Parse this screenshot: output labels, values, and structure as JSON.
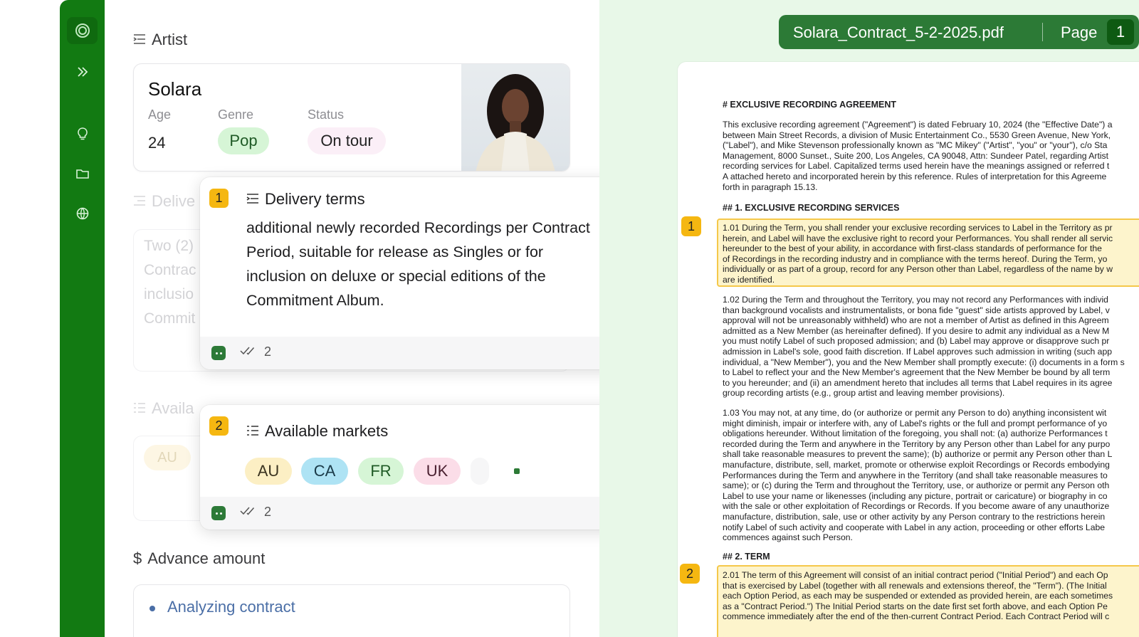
{
  "sidebar": {
    "icons": [
      "logo-ring-icon",
      "expand-chevrons-icon",
      "lightbulb-icon",
      "folder-icon",
      "globe-icon"
    ]
  },
  "artist_section": {
    "title": "Artist",
    "name": "Solara",
    "age_label": "Age",
    "age": "24",
    "genre_label": "Genre",
    "genre": "Pop",
    "status_label": "Status",
    "status": "On tour"
  },
  "faded": {
    "delivery_title": "Delive",
    "delivery_lines": [
      "Two (2)",
      "Contrac",
      "inclusio",
      "Commit"
    ],
    "markets_title": "Availa",
    "market_chip": "AU"
  },
  "popover_delivery": {
    "badge": "1",
    "title": "Delivery terms",
    "body": "additional newly recorded Recordings per Contract Period, suitable for release as Singles or for inclusion on deluxe or special editions of the Commitment Album.",
    "check_count": "2"
  },
  "popover_markets": {
    "badge": "2",
    "title": "Available markets",
    "markets": [
      "AU",
      "CA",
      "FR",
      "UK"
    ],
    "check_count": "2"
  },
  "advance": {
    "title": "Advance amount",
    "status": "Analyzing contract"
  },
  "document": {
    "file_name": "Solara_Contract_5-2-2025.pdf",
    "page_label": "Page",
    "page_number": "1",
    "heading": "# EXCLUSIVE RECORDING AGREEMENT",
    "intro_lines": [
      "This exclusive recording agreement (\"Agreement\") is dated February 10, 2024 (the \"Effective Date\") a",
      "between Main Street Records, a division of Music Entertainment Co., 5530 Green Avenue, New York,",
      "(\"Label\"), and Mike Stevenson professionally known as \"MC Mikey\" (\"Artist\", \"you\" or \"your\"), c/o Sta",
      "Management, 8000 Sunset., Suite 200, Los Angeles, CA 90048, Attn: Sundeer Patel, regarding Artist",
      "recording services for Label. Capitalized terms used herein have the meanings assigned or referred t",
      "A attached hereto and incorporated herein by this reference. Rules of interpretation for this Agreeme",
      "forth in paragraph 15.13."
    ],
    "section1_heading": "## 1. EXCLUSIVE RECORDING SERVICES",
    "badge1": "1",
    "p101_lines": [
      "1.01 During the Term, you shall render your exclusive recording services to Label in the Territory as pr",
      "herein, and Label will have the exclusive right to record your Performances. You shall render all servic",
      "hereunder to the best of your ability, in accordance with first-class standards of performance for the",
      "of Recordings in the recording industry and in compliance with the terms hereof. During the Term, yo",
      "individually or as part of a group, record for any Person other than Label, regardless of the name by w",
      "are identified."
    ],
    "p102_lines": [
      "1.02 During the Term and throughout the Territory, you may not record any Performances with individ",
      "than background vocalists and instrumentalists, or bona fide \"guest\" side artists approved by Label, v",
      "approval will not be unreasonably withheld) who are not a member of Artist as defined in this Agreem",
      "admitted as a New Member (as hereinafter defined). If you desire to admit any individual as a New M",
      "you must notify Label of such proposed admission; and (b) Label may approve or disapprove such pr",
      "admission in Label's sole, good faith discretion. If Label approves such admission in writing (such app",
      "individual, a \"New Member\"), you and the New Member shall promptly execute: (i) documents in a form s",
      "to Label to reflect your and the New Member's agreement that the New Member be bound by all term",
      "to you hereunder; and (ii) an amendment hereto that includes all terms that Label requires in its agree",
      "group recording artists (e.g., group artist and leaving member provisions)."
    ],
    "p103_lines": [
      "1.03 You may not, at any time, do (or authorize or permit any Person to do) anything inconsistent wit",
      "might diminish, impair or interfere with, any of Label's rights or the full and prompt performance of yo",
      "obligations hereunder. Without limitation of the foregoing, you shall not: (a) authorize Performances t",
      "recorded during the Term and anywhere in the Territory by any Person other than Label for any purpo",
      "shall take reasonable measures to prevent the same); (b) authorize or permit any Person other than L",
      "manufacture, distribute, sell, market, promote or otherwise exploit Recordings or Records embodying",
      "Performances during the Term and anywhere in the Territory (and shall take reasonable measures to",
      "same); or (c) during the Term and throughout the Territory, use, or authorize or permit any Person oth",
      "Label to use your name or likenesses (including any picture, portrait or caricature) or biography in co",
      "with the sale or other exploitation of Recordings or Records. If you become aware of any unauthorize",
      "manufacture, distribution, sale, use or other activity by any Person contrary to the restrictions herein",
      "notify Label of such activity and cooperate with Label in any action, proceeding or other efforts Labe",
      "commences against such Person."
    ],
    "section2_heading": "## 2. TERM",
    "badge2": "2",
    "p201_lines": [
      "2.01 The term of this Agreement will consist of an initial contract period (\"Initial Period\") and each Op",
      "that is exercised by Label (together with all renewals and extensions thereof, the \"Term\"). (The Initial",
      "each Option Period, as each may be suspended or extended as provided herein, are each sometimes",
      "as a \"Contract Period.\") The Initial Period starts on the date first set forth above, and each Option Pe",
      "commence immediately after the end of the then-current Contract Period. Each Contract Period will c"
    ]
  },
  "colors": {
    "sidebar_green": "#127a12",
    "accent_green": "#2c7a36",
    "badge_yellow": "#f5b711",
    "highlight_fill": "#fdf4cc",
    "doc_background": "#e8f8e8"
  }
}
